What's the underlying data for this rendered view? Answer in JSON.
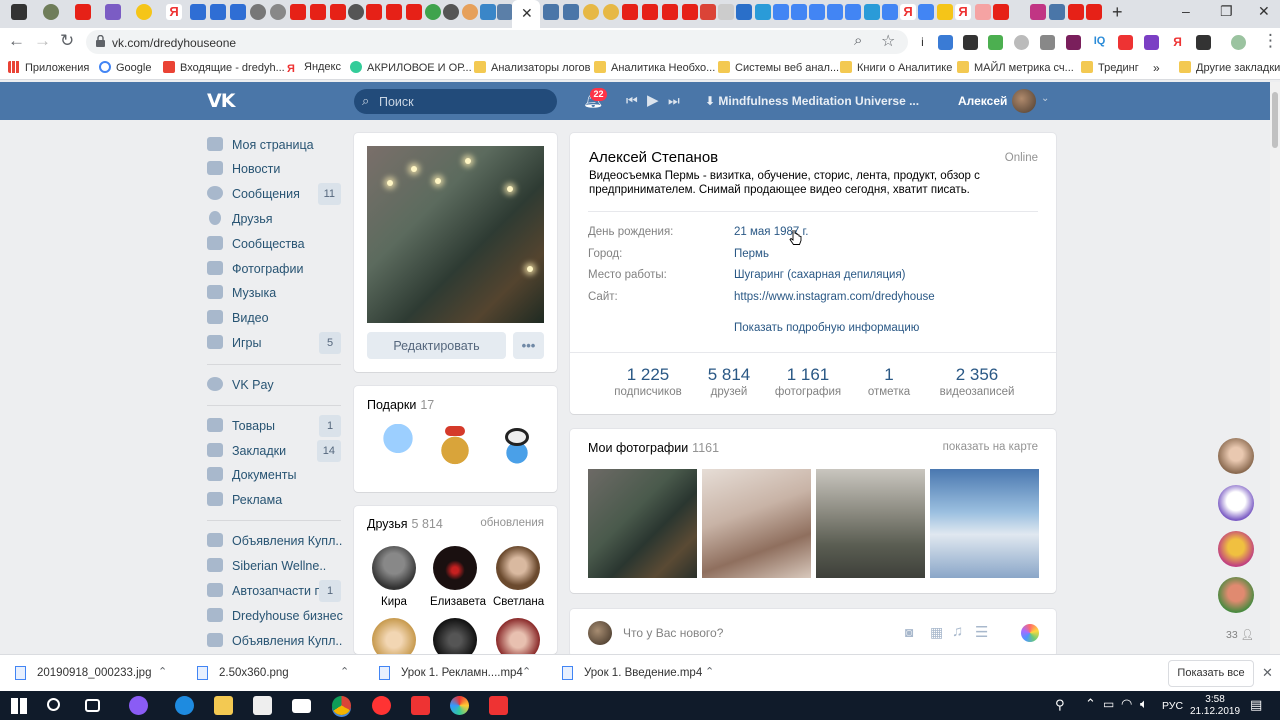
{
  "browser": {
    "url": "vk.com/dredyhouseone",
    "bookmarks": [
      "Приложения",
      "Google",
      "Входящие - dredyh...",
      "Яндекс",
      "АКРИЛОВОЕ И ОР...",
      "Анализаторы логов",
      "Аналитика Необхо...",
      "Системы веб анал...",
      "Книги о Аналитике",
      "МАЙЛ метрика сч...",
      "Трединг",
      "»",
      "Другие закладки"
    ]
  },
  "vk_header": {
    "logo": "VK",
    "search_placeholder": "Поиск",
    "notifications_count": "22",
    "now_playing": "Mindfulness Meditation Universe ...",
    "user_name": "Алексей"
  },
  "left_menu": [
    {
      "label": "Моя страница",
      "count": ""
    },
    {
      "label": "Новости",
      "count": ""
    },
    {
      "label": "Сообщения",
      "count": "11"
    },
    {
      "label": "Друзья",
      "count": ""
    },
    {
      "label": "Сообщества",
      "count": ""
    },
    {
      "label": "Фотографии",
      "count": ""
    },
    {
      "label": "Музыка",
      "count": ""
    },
    {
      "label": "Видео",
      "count": ""
    },
    {
      "label": "Игры",
      "count": "5"
    },
    {
      "label": "VK Pay",
      "count": ""
    },
    {
      "label": "Товары",
      "count": "1"
    },
    {
      "label": "Закладки",
      "count": "14"
    },
    {
      "label": "Документы",
      "count": ""
    },
    {
      "label": "Реклама",
      "count": ""
    },
    {
      "label": "Объявления Купл..",
      "count": ""
    },
    {
      "label": "Siberian Wellne..",
      "count": ""
    },
    {
      "label": "Автозапчасти п...",
      "count": "1"
    },
    {
      "label": "Dredyhouse бизнес",
      "count": ""
    },
    {
      "label": "Объявления Купл..",
      "count": ""
    }
  ],
  "profile_card": {
    "edit_button": "Редактировать",
    "more_button": "•••"
  },
  "gifts": {
    "title": "Подарки",
    "count": "17"
  },
  "friends": {
    "title": "Друзья",
    "count": "5 814",
    "updates_link": "обновления",
    "items": [
      "Кира",
      "Елизавета",
      "Светлана"
    ]
  },
  "profile": {
    "name": "Алексей Степанов",
    "online": "Online",
    "status": "Видеосъемка Пермь - визитка, обучение, сторис, лента, продукт, обзор с предпринимателем. Снимай продающее видео сегодня, хватит писать.",
    "info": [
      {
        "label": "День рождения:",
        "value": "21 мая 1987 г."
      },
      {
        "label": "Город:",
        "value": "Пермь"
      },
      {
        "label": "Место работы:",
        "value": "Шугаринг (сахарная депиляция)"
      },
      {
        "label": "Сайт:",
        "value": "https://www.instagram.com/dredyhouse"
      }
    ],
    "more_info_link": "Показать подробную информацию",
    "stats": [
      {
        "num": "1 225",
        "label": "подписчиков"
      },
      {
        "num": "5 814",
        "label": "друзей"
      },
      {
        "num": "1 161",
        "label": "фотография"
      },
      {
        "num": "1",
        "label": "отметка"
      },
      {
        "num": "2 356",
        "label": "видеозаписей"
      }
    ]
  },
  "photos": {
    "title": "Мои фотографии",
    "count": "1161",
    "map_link": "показать на карте"
  },
  "post_box": {
    "placeholder": "Что у Вас нового?"
  },
  "right_column": {
    "online_count": "33"
  },
  "downloads": {
    "items": [
      "20190918_000233.jpg",
      "2.50x360.png",
      "Урок 1. Рекламн....mp4",
      "Урок 1. Введение.mp4"
    ],
    "show_all": "Показать все"
  },
  "taskbar": {
    "lang": "РУС",
    "time": "3:58",
    "date": "21.12.2019"
  }
}
